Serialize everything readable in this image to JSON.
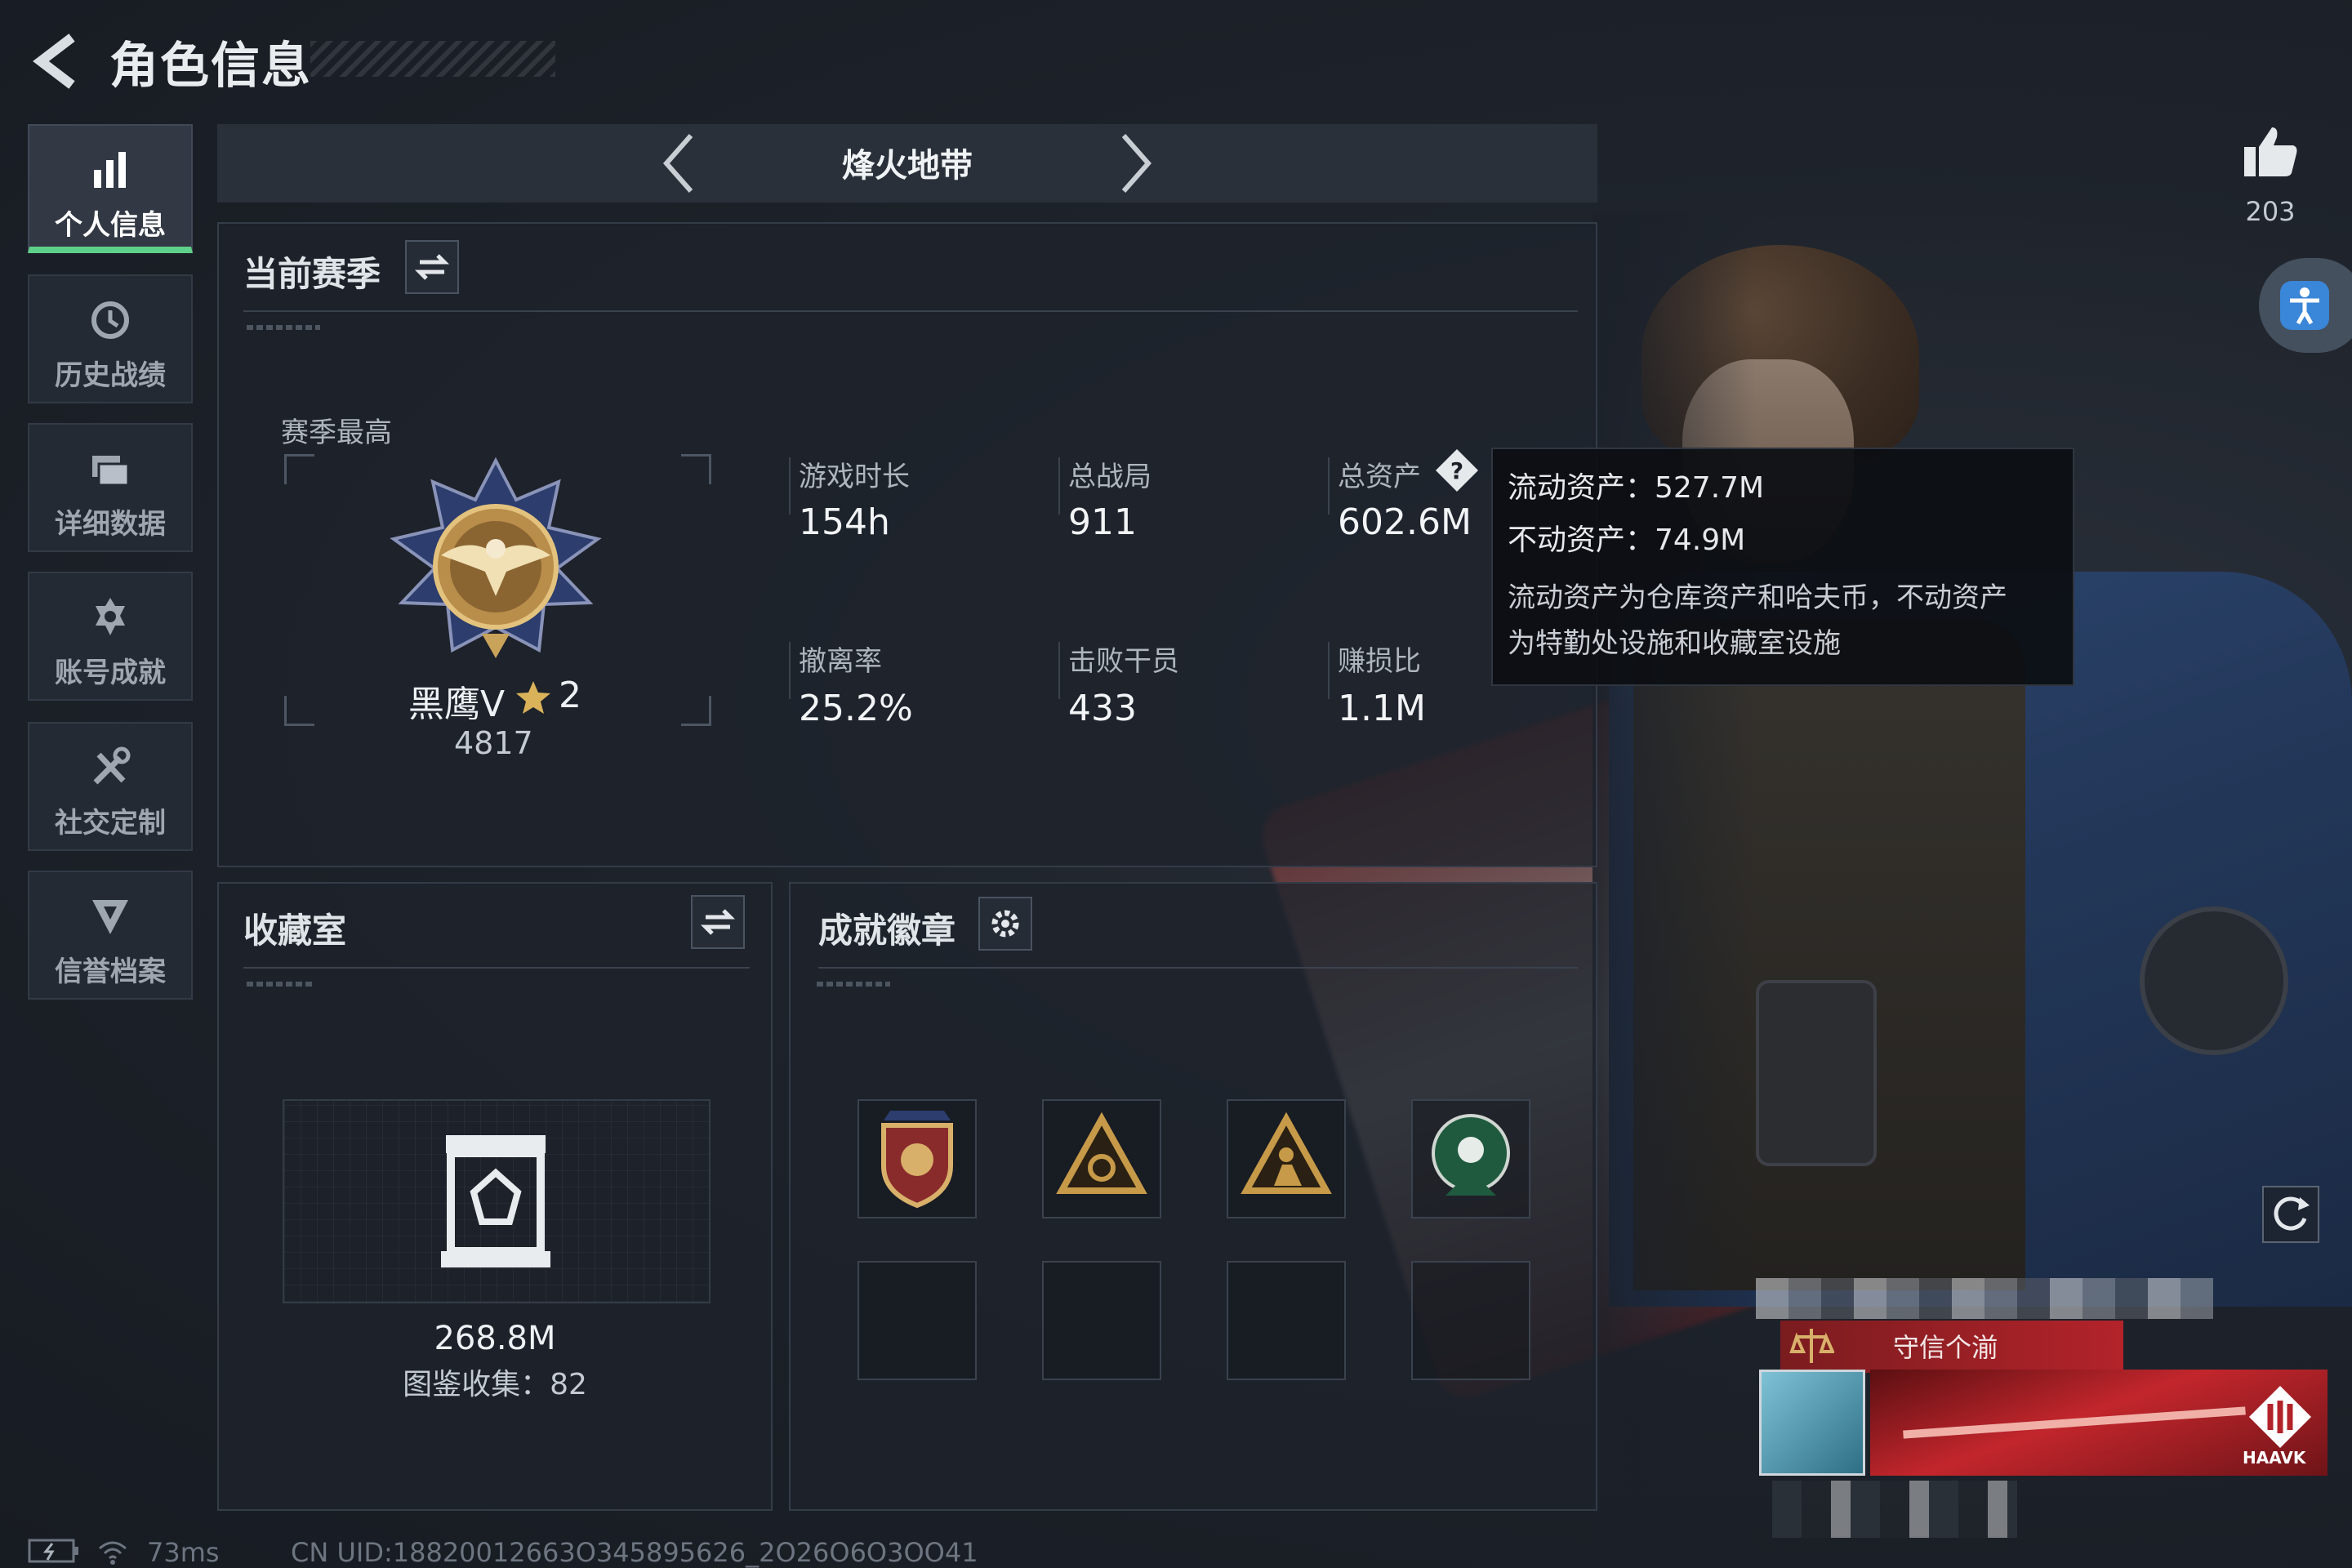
{
  "header": {
    "title": "角色信息"
  },
  "sidebar": {
    "items": [
      {
        "label": "个人信息",
        "icon": "bar-chart-icon",
        "active": true
      },
      {
        "label": "历史战绩",
        "icon": "history-clock-icon",
        "active": false
      },
      {
        "label": "详细数据",
        "icon": "folder-stack-icon",
        "active": false
      },
      {
        "label": "账号成就",
        "icon": "achievement-icon",
        "active": false
      },
      {
        "label": "社交定制",
        "icon": "wrench-tools-icon",
        "active": false
      },
      {
        "label": "信誉档案",
        "icon": "shield-emblem-icon",
        "active": false
      }
    ]
  },
  "mode_selector": {
    "current": "烽火地带"
  },
  "current_season": {
    "title": "当前赛季",
    "season_best_label": "赛季最高",
    "rank_name": "黑鹰V",
    "rank_stars": "2",
    "rank_score": "4817",
    "stats": [
      {
        "label": "游戏时长",
        "value": "154h"
      },
      {
        "label": "总战局",
        "value": "911"
      },
      {
        "label": "总资产",
        "value": "602.6M",
        "has_help": true
      },
      {
        "label": "撤离率",
        "value": "25.2%"
      },
      {
        "label": "击败干员",
        "value": "433"
      },
      {
        "label": "赚损比",
        "value": "1.1M"
      }
    ]
  },
  "asset_tooltip": {
    "liquid": "流动资产：527.7M",
    "fixed": "不动资产：74.9M",
    "desc_line1": "流动资产为仓库资产和哈夫币，不动资产",
    "desc_line2": "为特勤处设施和收藏室设施"
  },
  "collection": {
    "title": "收藏室",
    "value": "268.8M",
    "catalog": "图鉴收集：82"
  },
  "badges": {
    "title": "成就徽章",
    "items": [
      "eagle-shield-badge-icon",
      "gold-triangle-badge-icon",
      "gold-triangle-figure-badge-icon",
      "green-skull-badge-icon"
    ],
    "empty_slots": 4
  },
  "social": {
    "likes": "203"
  },
  "nameplate": {
    "label": "守信个湔",
    "brand": "HAAVK"
  },
  "status_bar": {
    "ping": "73ms",
    "uid": "CN UID:18820012663O345895626_2O26O6O3OO41"
  },
  "colors": {
    "accent_green": "#5fd08a",
    "panel_bg": "#1e232c",
    "nameplate_red": "#b3232a"
  }
}
